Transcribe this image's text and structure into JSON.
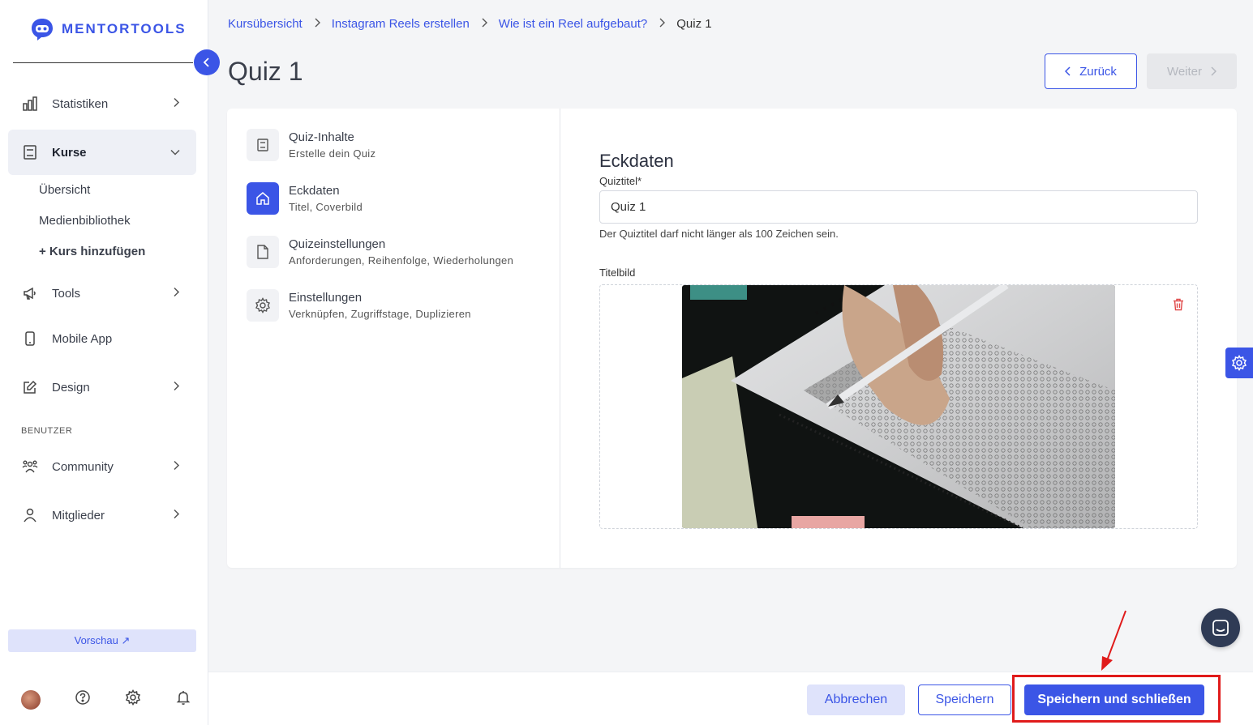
{
  "brand": {
    "name": "MENTORTOOLS"
  },
  "sidebar": {
    "items": [
      {
        "label": "Statistiken",
        "icon": "bar-chart-icon"
      },
      {
        "label": "Kurse",
        "icon": "book-icon"
      },
      {
        "label": "Tools",
        "icon": "megaphone-icon"
      },
      {
        "label": "Mobile App",
        "icon": "phone-icon"
      },
      {
        "label": "Design",
        "icon": "edit-icon"
      },
      {
        "label": "Community",
        "icon": "users-icon"
      },
      {
        "label": "Mitglieder",
        "icon": "user-icon"
      }
    ],
    "sub_items": [
      "Übersicht",
      "Medienbibliothek",
      "+ Kurs hinzufügen"
    ],
    "section_label": "BENUTZER",
    "preview_label": "Vorschau ↗"
  },
  "breadcrumb": [
    "Kursübersicht",
    "Instagram Reels erstellen",
    "Wie ist ein Reel aufgebaut?",
    "Quiz 1"
  ],
  "page": {
    "title": "Quiz 1",
    "back_label": "Zurück",
    "next_label": "Weiter"
  },
  "steps": [
    {
      "title": "Quiz-Inhalte",
      "subtitle": "Erstelle dein Quiz"
    },
    {
      "title": "Eckdaten",
      "subtitle": "Titel, Coverbild"
    },
    {
      "title": "Quizeinstellungen",
      "subtitle": "Anforderungen, Reihenfolge, Wiederholungen"
    },
    {
      "title": "Einstellungen",
      "subtitle": "Verknüpfen, Zugriffstage, Duplizieren"
    }
  ],
  "form": {
    "title": "Eckdaten",
    "quiz_title_label": "Quiztitel*",
    "quiz_title_value": "Quiz 1",
    "quiz_title_help": "Der Quiztitel darf nicht länger als 100 Zeichen sein.",
    "cover_label": "Titelbild"
  },
  "footer": {
    "cancel_label": "Abbrechen",
    "save_label": "Speichern",
    "save_close_label": "Speichern und schließen"
  },
  "colors": {
    "accent": "#3b55e6",
    "annotation": "#e01b1b"
  }
}
